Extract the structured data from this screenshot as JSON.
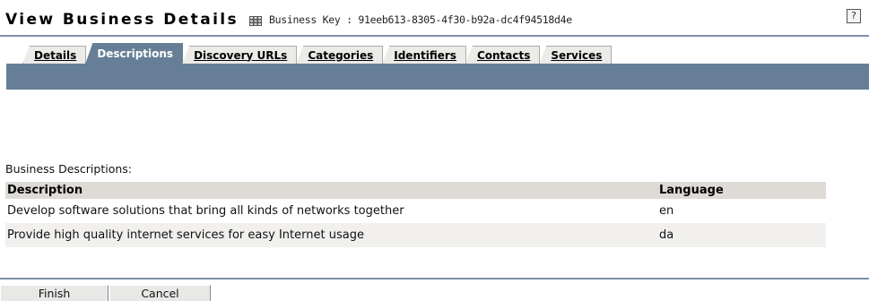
{
  "header": {
    "title": "View Business Details",
    "icon": "keypad-icon",
    "business_key": "Business Key : 91eeb613-8305-4f30-b92a-dc4f94518d4e",
    "help_label": "?"
  },
  "tabs": [
    {
      "label": "Details",
      "active": false
    },
    {
      "label": "Descriptions",
      "active": true
    },
    {
      "label": "Discovery URLs",
      "active": false
    },
    {
      "label": "Categories",
      "active": false
    },
    {
      "label": "Identifiers",
      "active": false
    },
    {
      "label": "Contacts",
      "active": false
    },
    {
      "label": "Services",
      "active": false
    }
  ],
  "descriptions": {
    "section_label": "Business Descriptions:",
    "columns": [
      "Description",
      "Language"
    ],
    "rows": [
      {
        "description": "Develop software solutions that bring all kinds of networks together",
        "language": "en"
      },
      {
        "description": "Provide high quality internet services for easy Internet usage",
        "language": "da"
      }
    ]
  },
  "actions": {
    "finish": "Finish",
    "cancel": "Cancel"
  },
  "colors": {
    "accent": "#667f97",
    "rule": "#7d91a6",
    "header_row": "#dedbd6"
  }
}
